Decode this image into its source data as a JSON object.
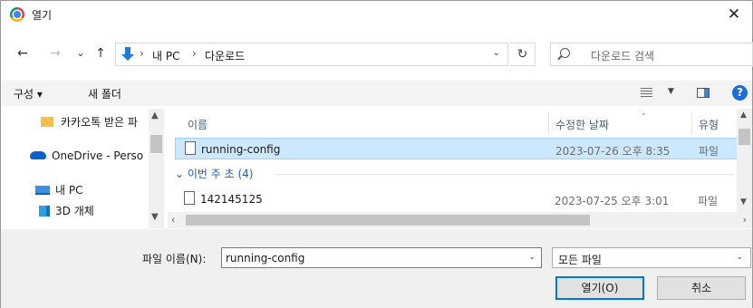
{
  "window": {
    "title": "열기",
    "close_glyph": "✕"
  },
  "nav": {
    "back_glyph": "←",
    "forward_glyph": "→",
    "recent_glyph": "⌄",
    "up_glyph": "↑",
    "breadcrumb": [
      "내 PC",
      "다운로드"
    ],
    "crumb_sep": "›",
    "addr_dropdown_glyph": "⌄",
    "refresh_glyph": "↻",
    "search_placeholder": "다운로드 검색"
  },
  "toolbar": {
    "organize_label": "구성 ▾",
    "new_folder_label": "새 폴더",
    "view_dropdown_glyph": "▼",
    "help_glyph": "?"
  },
  "navpane": {
    "items": [
      {
        "label": "카카오톡 받은 파",
        "icon": "folder-icon"
      },
      {
        "label": "OneDrive - Perso",
        "icon": "onedrive-cloud-icon"
      },
      {
        "label": "내 PC",
        "icon": "pc-icon"
      },
      {
        "label": "3D 개체",
        "icon": "3d-objects-icon"
      }
    ]
  },
  "filelist": {
    "columns": {
      "name": "이름",
      "date": "수정한 날짜",
      "type": "유형"
    },
    "selected_row": {
      "name": "running-config",
      "date": "2023-07-26 오후 8:35",
      "type": "파일"
    },
    "group_label": "이번 주 초 (4)",
    "group_chevron": "⌄",
    "rows": [
      {
        "name": "142145125",
        "date": "2023-07-25 오후 3:01",
        "type": "파일"
      }
    ]
  },
  "bottom": {
    "filename_label": "파일 이름(N):",
    "filename_value": "running-config",
    "filetype_value": "모든 파일",
    "dropdown_glyph": "⌄",
    "open_button": "열기(O)",
    "cancel_button": "취소"
  },
  "colors": {
    "accent": "#0078d7",
    "selection": "#cce8ff",
    "toolbar_bg": "#f3f3f3"
  }
}
